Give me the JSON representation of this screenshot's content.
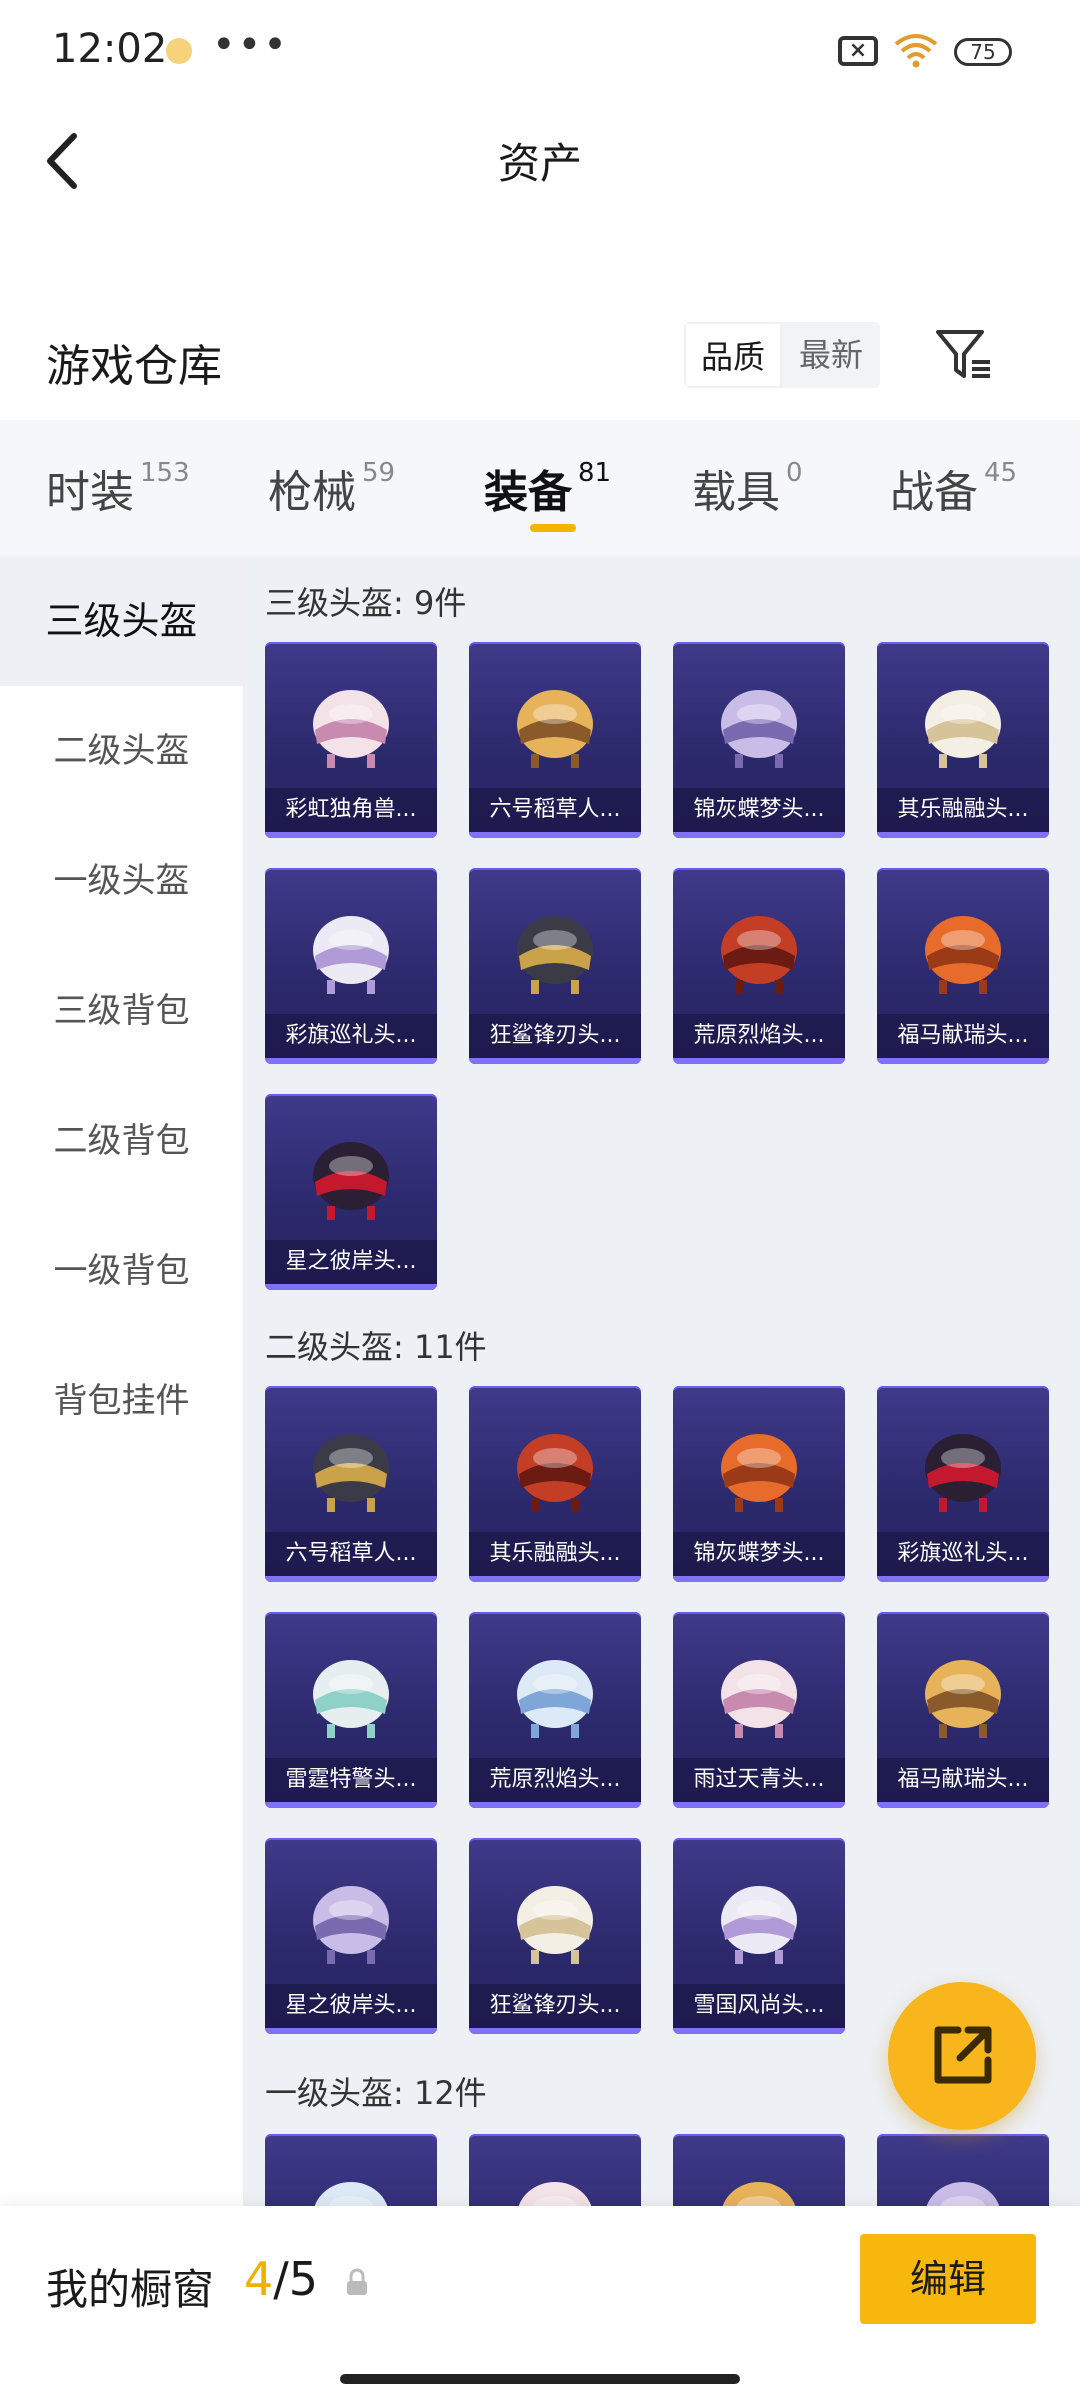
{
  "status_bar": {
    "time": "12:02",
    "more": "•••",
    "sim_icon": "sim-x-icon",
    "wifi_icon": "wifi-icon",
    "battery": "75"
  },
  "header": {
    "back_icon": "chevron-left-icon",
    "title": "资产"
  },
  "section": {
    "title": "游戏仓库",
    "sort_options": [
      "品质",
      "最新"
    ],
    "sort_selected": "品质",
    "filter_icon": "filter-icon"
  },
  "tabs": [
    {
      "label": "时装",
      "count": "153"
    },
    {
      "label": "枪械",
      "count": "59"
    },
    {
      "label": "装备",
      "count": "81",
      "active": true
    },
    {
      "label": "载具",
      "count": "0"
    },
    {
      "label": "战备",
      "count": "45"
    }
  ],
  "sidebar": [
    "三级头盔",
    "二级头盔",
    "一级头盔",
    "三级背包",
    "二级背包",
    "一级背包",
    "背包挂件"
  ],
  "sidebar_active": "三级头盔",
  "groups": [
    {
      "label": "三级头盔: 9件",
      "items": [
        "彩虹独角兽...",
        "六号稻草人...",
        "锦灰蝶梦头...",
        "其乐融融头...",
        "彩旗巡礼头...",
        "狂鲨锋刃头...",
        "荒原烈焰头...",
        "福马献瑞头...",
        "星之彼岸头..."
      ]
    },
    {
      "label": "二级头盔: 11件",
      "items": [
        "六号稻草人...",
        "其乐融融头...",
        "锦灰蝶梦头...",
        "彩旗巡礼头...",
        "雷霆特警头...",
        "荒原烈焰头...",
        "雨过天青头...",
        "福马献瑞头...",
        "星之彼岸头...",
        "狂鲨锋刃头...",
        "雪国风尚头..."
      ]
    },
    {
      "label": "一级头盔: 12件",
      "items": [
        "",
        "",
        "",
        ""
      ]
    }
  ],
  "fab_icon": "share-out-icon",
  "bottom": {
    "label": "我的橱窗",
    "current": "4",
    "total": "/5",
    "lock_icon": "lock-icon",
    "edit": "编辑"
  },
  "colors": {
    "accent": "#f8b70d",
    "card_bg": "#2f2b74",
    "card_border": "#8072f5"
  }
}
